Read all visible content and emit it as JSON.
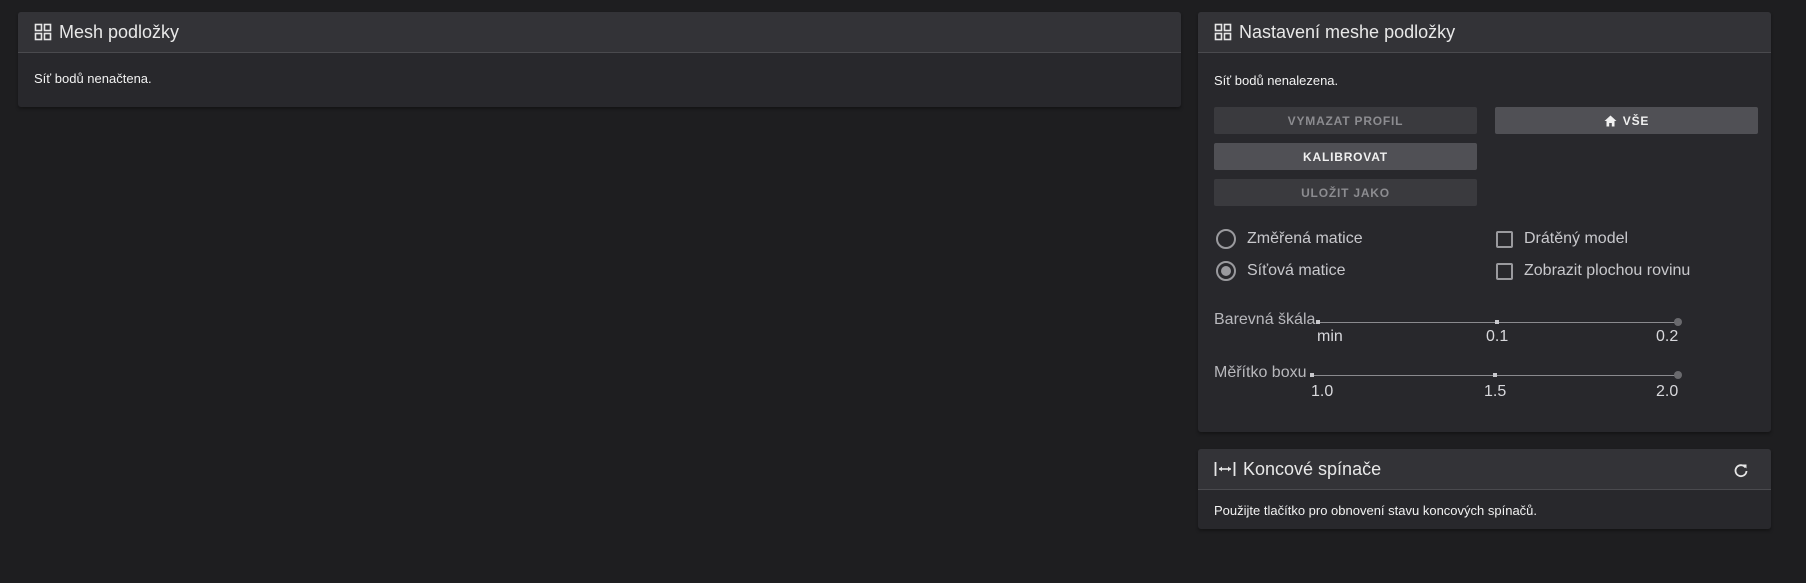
{
  "mesh_panel": {
    "title": "Mesh podložky",
    "icon": "grid-icon",
    "message": "Síť bodů nenačtena."
  },
  "settings_panel": {
    "title": "Nastavení meshe podložky",
    "icon": "grid-icon",
    "message": "Síť bodů nenalezena.",
    "buttons": {
      "clear_profile": "VYMAZAT PROFIL",
      "calibrate": "KALIBROVAT",
      "save_as": "ULOŽIT JAKO",
      "home_all": "VŠE"
    },
    "radios": [
      {
        "label": "Změřená matice",
        "checked": false
      },
      {
        "label": "Síťová matice",
        "checked": true
      }
    ],
    "checkboxes": [
      {
        "label": "Drátěný model",
        "checked": false
      },
      {
        "label": "Zobrazit plochou rovinu",
        "checked": false
      }
    ],
    "sliders": [
      {
        "label": "Barevná škála",
        "ticks": [
          "min",
          "0.1",
          "0.2"
        ],
        "value": "0.2"
      },
      {
        "label": "Měřítko boxu",
        "ticks": [
          "1.0",
          "1.5",
          "2.0"
        ],
        "value": "2.0"
      }
    ]
  },
  "endstops_panel": {
    "title": "Koncové spínače",
    "icon": "arrows-horizontal-icon",
    "refresh_icon": "refresh-icon",
    "message": "Použijte tlačítko pro obnovení stavu koncových spínačů."
  },
  "colors": {
    "background": "#1e1e20",
    "panel": "#28282c",
    "header": "#333337",
    "button_enabled": "#505055",
    "button_disabled": "#3a3a3e"
  }
}
